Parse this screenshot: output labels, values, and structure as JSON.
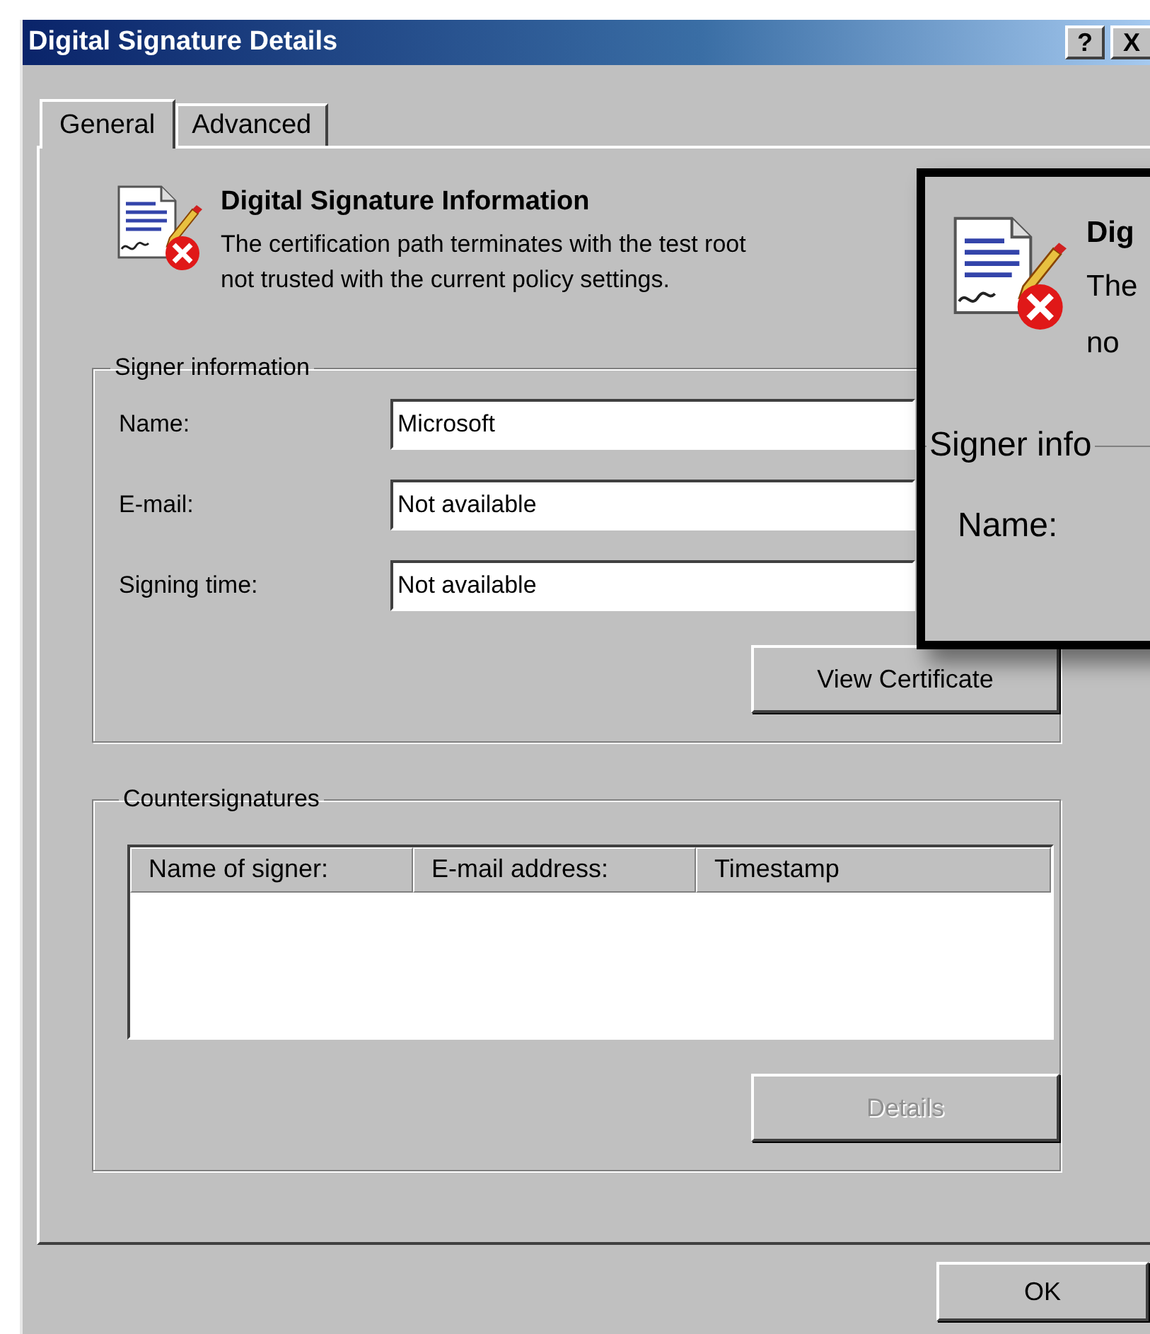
{
  "window": {
    "title": "Digital Signature Details",
    "title_buttons": [
      {
        "kind": "help",
        "label": "?"
      },
      {
        "kind": "close",
        "label": "X"
      }
    ]
  },
  "tabs": [
    {
      "label": "General",
      "selected": true
    },
    {
      "label": "Advanced",
      "selected": false
    }
  ],
  "info": {
    "heading": "Digital Signature Information",
    "description_lines": [
      "The certification path terminates with the test root",
      "not trusted with the current policy settings."
    ]
  },
  "signer_information": {
    "title": "Signer information",
    "fields": [
      {
        "label": "Name:",
        "value": "Microsoft"
      },
      {
        "label": "E-mail:",
        "value": "Not available"
      },
      {
        "label": "Signing time:",
        "value": "Not available"
      }
    ],
    "button": {
      "label": "View Certificate",
      "disabled": false
    }
  },
  "countersignatures": {
    "title": "Countersignatures",
    "columns": [
      "Name of signer:",
      "E-mail address:",
      "Timestamp"
    ],
    "button": {
      "label": "Details",
      "disabled": true
    }
  },
  "buttons": [
    {
      "label": "OK",
      "disabled": false
    }
  ],
  "magnified_inset": {
    "heading": "Dig",
    "lines": [
      "The",
      "no"
    ],
    "group_title": "Signer info",
    "field_label": "Name:"
  }
}
